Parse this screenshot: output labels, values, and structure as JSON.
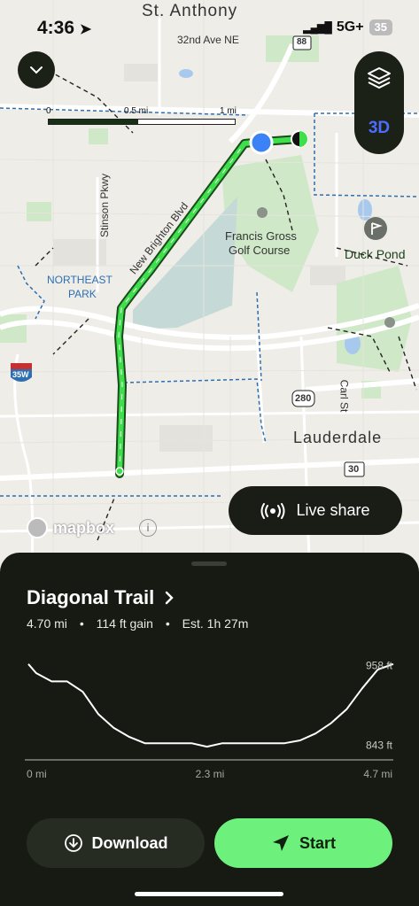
{
  "status": {
    "time": "4:36",
    "network": "5G+",
    "battery": "35"
  },
  "map": {
    "labels": {
      "st_anthony": "St. Anthony",
      "ave32": "32nd Ave NE",
      "route88": "88",
      "stinson": "Stinson Pkwy",
      "new_brighton": "New Brighton Blvd",
      "golf": "Francis Gross",
      "golf2": "Golf Course",
      "duck": "Duck Pond",
      "ne_park": "NORTHEAST",
      "ne_park2": "PARK",
      "i35w": "35W",
      "route280": "280",
      "carl": "Carl St",
      "lauderdale": "Lauderdale",
      "route30": "30"
    },
    "scale": {
      "t0": "0",
      "t1": "0.5 mi",
      "t2": "1 mi"
    },
    "layers_3d": "3D",
    "attribution": "mapbox",
    "live_share": "Live share",
    "colors": {
      "route": "#3de04b",
      "user": "#3b82f6"
    }
  },
  "trail": {
    "name": "Diagonal Trail",
    "distance": "4.70 mi",
    "gain": "114 ft gain",
    "estimate": "Est. 1h 27m"
  },
  "chart_data": {
    "type": "line",
    "x": [
      0,
      0.1,
      0.3,
      0.5,
      0.7,
      0.9,
      1.1,
      1.3,
      1.5,
      1.7,
      1.9,
      2.1,
      2.3,
      2.5,
      2.7,
      2.9,
      3.1,
      3.3,
      3.5,
      3.7,
      3.9,
      4.1,
      4.3,
      4.5,
      4.7
    ],
    "y": [
      960,
      947,
      935,
      935,
      920,
      888,
      868,
      855,
      846,
      846,
      846,
      846,
      841,
      846,
      846,
      846,
      846,
      846,
      850,
      860,
      875,
      895,
      925,
      952,
      960
    ],
    "ylabels": [
      "958 ft",
      "843 ft"
    ],
    "xlabels": [
      "0 mi",
      "2.3 mi",
      "4.7 mi"
    ],
    "ylim": [
      822,
      975
    ],
    "xlim": [
      0,
      4.7
    ]
  },
  "actions": {
    "download": "Download",
    "start": "Start"
  }
}
